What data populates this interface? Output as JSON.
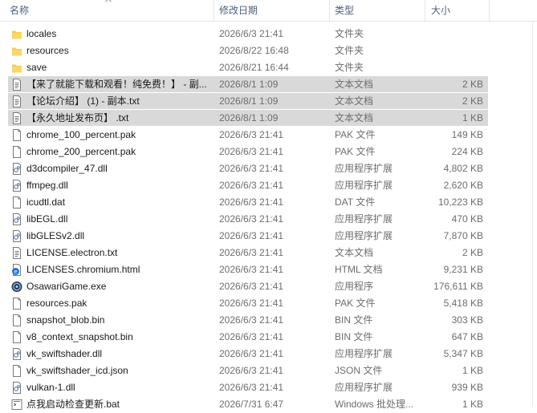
{
  "columns": {
    "name": "名称",
    "modified": "修改日期",
    "type": "类型",
    "size": "大小"
  },
  "files": [
    {
      "name": "locales",
      "modified": "2026/6/3 21:41",
      "type": "文件夹",
      "size": "",
      "icon": "folder-icon",
      "selected": false
    },
    {
      "name": "resources",
      "modified": "2026/8/22 16:48",
      "type": "文件夹",
      "size": "",
      "icon": "folder-icon",
      "selected": false
    },
    {
      "name": "save",
      "modified": "2026/8/21 16:44",
      "type": "文件夹",
      "size": "",
      "icon": "folder-icon",
      "selected": false
    },
    {
      "name": "【来了就能下载和观看！纯免费！】 - 副...",
      "modified": "2026/8/1 1:09",
      "type": "文本文档",
      "size": "2 KB",
      "icon": "text-file-icon",
      "selected": true
    },
    {
      "name": "【论坛介绍】 (1) - 副本.txt",
      "modified": "2026/8/1 1:09",
      "type": "文本文档",
      "size": "2 KB",
      "icon": "text-file-icon",
      "selected": true
    },
    {
      "name": "【永久地址发布页】 .txt",
      "modified": "2026/8/1 1:09",
      "type": "文本文档",
      "size": "1 KB",
      "icon": "text-file-icon",
      "selected": true
    },
    {
      "name": "chrome_100_percent.pak",
      "modified": "2026/6/3 21:41",
      "type": "PAK 文件",
      "size": "149 KB",
      "icon": "file-icon",
      "selected": false
    },
    {
      "name": "chrome_200_percent.pak",
      "modified": "2026/6/3 21:41",
      "type": "PAK 文件",
      "size": "224 KB",
      "icon": "file-icon",
      "selected": false
    },
    {
      "name": "d3dcompiler_47.dll",
      "modified": "2026/6/3 21:41",
      "type": "应用程序扩展",
      "size": "4,802 KB",
      "icon": "dll-file-icon",
      "selected": false
    },
    {
      "name": "ffmpeg.dll",
      "modified": "2026/6/3 21:41",
      "type": "应用程序扩展",
      "size": "2,620 KB",
      "icon": "dll-file-icon",
      "selected": false
    },
    {
      "name": "icudtl.dat",
      "modified": "2026/6/3 21:41",
      "type": "DAT 文件",
      "size": "10,223 KB",
      "icon": "file-icon",
      "selected": false
    },
    {
      "name": "libEGL.dll",
      "modified": "2026/6/3 21:41",
      "type": "应用程序扩展",
      "size": "470 KB",
      "icon": "dll-file-icon",
      "selected": false
    },
    {
      "name": "libGLESv2.dll",
      "modified": "2026/6/3 21:41",
      "type": "应用程序扩展",
      "size": "7,870 KB",
      "icon": "dll-file-icon",
      "selected": false
    },
    {
      "name": "LICENSE.electron.txt",
      "modified": "2026/6/3 21:41",
      "type": "文本文档",
      "size": "2 KB",
      "icon": "text-file-icon",
      "selected": false
    },
    {
      "name": "LICENSES.chromium.html",
      "modified": "2026/6/3 21:41",
      "type": "HTML 文档",
      "size": "9,231 KB",
      "icon": "html-file-icon",
      "selected": false
    },
    {
      "name": "OsawariGame.exe",
      "modified": "2026/6/3 21:41",
      "type": "应用程序",
      "size": "176,611 KB",
      "icon": "app-exe-icon",
      "selected": false
    },
    {
      "name": "resources.pak",
      "modified": "2026/6/3 21:41",
      "type": "PAK 文件",
      "size": "5,418 KB",
      "icon": "file-icon",
      "selected": false
    },
    {
      "name": "snapshot_blob.bin",
      "modified": "2026/6/3 21:41",
      "type": "BIN 文件",
      "size": "303 KB",
      "icon": "file-icon",
      "selected": false
    },
    {
      "name": "v8_context_snapshot.bin",
      "modified": "2026/6/3 21:41",
      "type": "BIN 文件",
      "size": "647 KB",
      "icon": "file-icon",
      "selected": false
    },
    {
      "name": "vk_swiftshader.dll",
      "modified": "2026/6/3 21:41",
      "type": "应用程序扩展",
      "size": "5,347 KB",
      "icon": "dll-file-icon",
      "selected": false
    },
    {
      "name": "vk_swiftshader_icd.json",
      "modified": "2026/6/3 21:41",
      "type": "JSON 文件",
      "size": "1 KB",
      "icon": "file-icon",
      "selected": false
    },
    {
      "name": "vulkan-1.dll",
      "modified": "2026/6/3 21:41",
      "type": "应用程序扩展",
      "size": "939 KB",
      "icon": "dll-file-icon",
      "selected": false
    },
    {
      "name": "点我启动检查更新.bat",
      "modified": "2026/7/31 6:47",
      "type": "Windows 批处理...",
      "size": "1 KB",
      "icon": "batch-file-icon",
      "selected": false
    }
  ],
  "colors": {
    "header_text": "#4c607a",
    "selection": "#d9d9d9",
    "folder": "#f8c94a"
  }
}
